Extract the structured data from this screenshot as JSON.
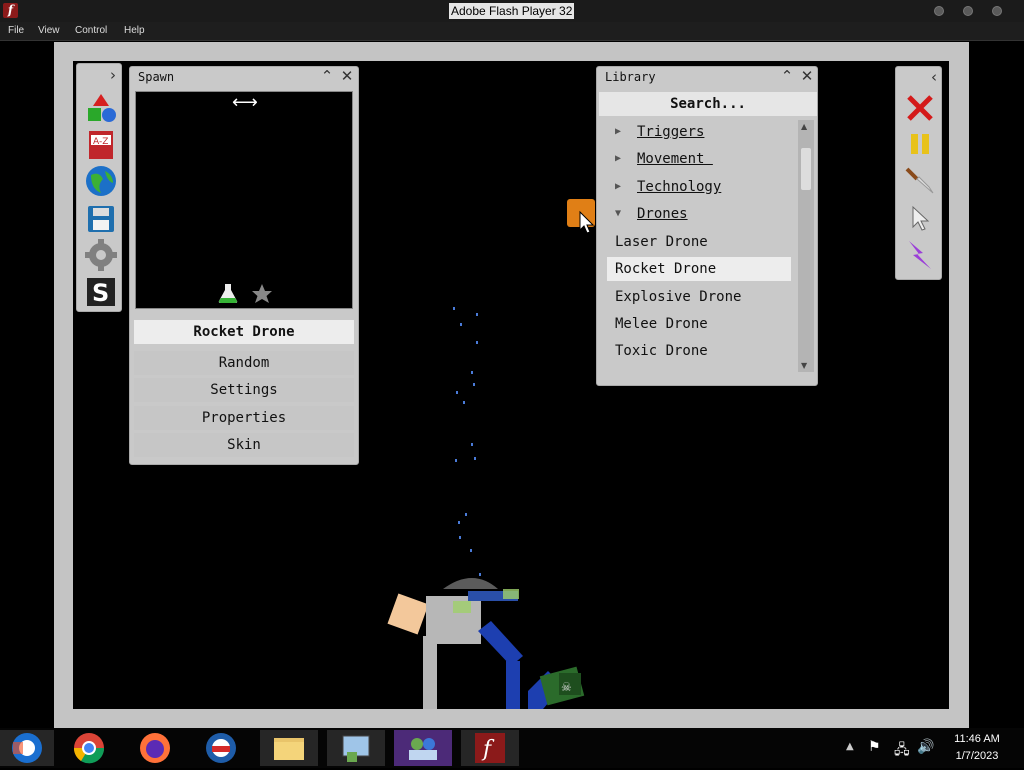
{
  "window": {
    "title": "Adobe Flash Player 32"
  },
  "menu": [
    "File",
    "View",
    "Control",
    "Help"
  ],
  "spawn": {
    "title": "Spawn",
    "selected": "Rocket Drone",
    "options": [
      "Random",
      "Settings",
      "Properties",
      "Skin"
    ]
  },
  "library": {
    "title": "Library",
    "search_placeholder": "Search...",
    "categories": [
      "Triggers",
      "Movement ",
      "Technology",
      "Drones"
    ],
    "items": [
      "Laser Drone",
      "Rocket Drone",
      "Explosive Drone",
      "Melee Drone",
      "Toxic Drone"
    ],
    "selected_item": "Rocket Drone"
  },
  "left_toolbar_icons": [
    "shapes-icon",
    "a-z-book-icon",
    "globe-icon",
    "save-disk-icon",
    "gear-icon",
    "s-logo-icon"
  ],
  "right_toolbar_icons": [
    "delete-x-icon",
    "pause-icon",
    "knife-icon",
    "cursor-icon",
    "lightning-icon"
  ],
  "taskbar": {
    "apps": [
      "chrome-icon",
      "firefox-icon",
      "opera-icon",
      "file-explorer-icon",
      "control-panel-icon",
      "people-icon",
      "flash-player-icon"
    ],
    "time": "11:46 AM",
    "date": "1/7/2023"
  },
  "colors": {
    "panel": "#c9c9c9",
    "selected_row": "#ededed",
    "stage_bg": "#000000",
    "frame": "#c4c4c4"
  }
}
